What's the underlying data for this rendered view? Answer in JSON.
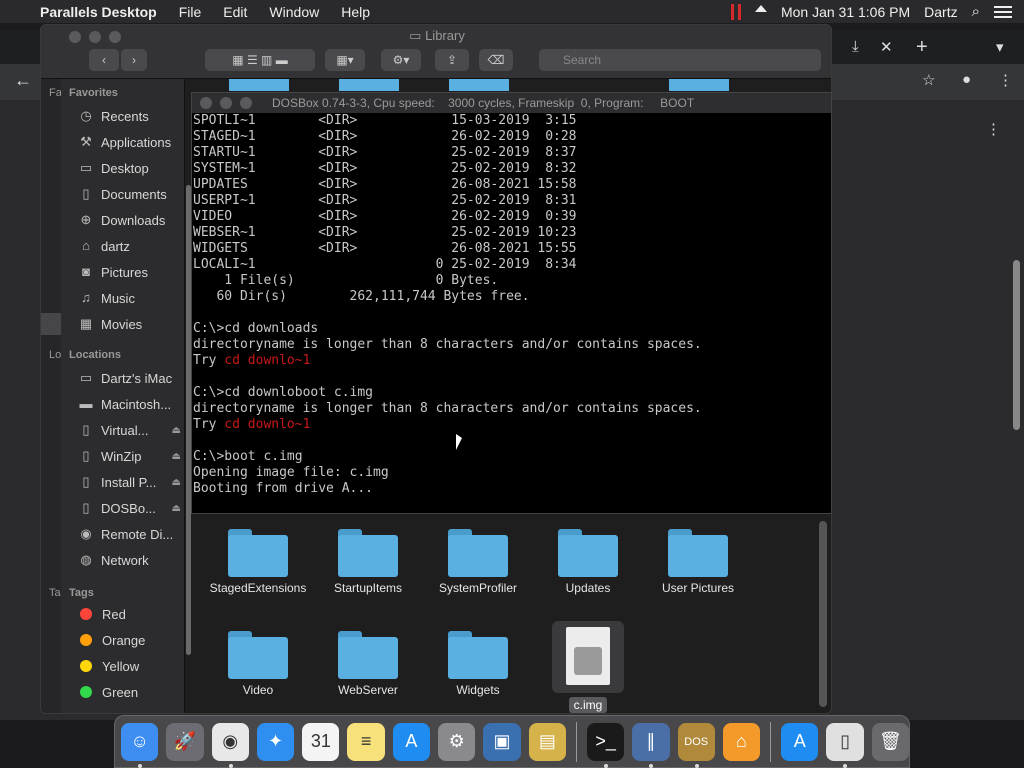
{
  "menubar": {
    "app": "Parallels Desktop",
    "items": [
      "File",
      "Edit",
      "Window",
      "Help"
    ],
    "datetime": "Mon Jan 31  1:06 PM",
    "user": "Dartz"
  },
  "finder": {
    "title": "Library",
    "search_placeholder": "Search",
    "favorites_header": "Favorites",
    "favorites": [
      {
        "label": "Recents",
        "icon": "clock-icon"
      },
      {
        "label": "Applications",
        "icon": "applications-icon"
      },
      {
        "label": "Desktop",
        "icon": "desktop-icon"
      },
      {
        "label": "Documents",
        "icon": "document-icon"
      },
      {
        "label": "Downloads",
        "icon": "download-icon"
      },
      {
        "label": "dartz",
        "icon": "home-icon"
      },
      {
        "label": "Pictures",
        "icon": "camera-icon"
      },
      {
        "label": "Music",
        "icon": "music-icon"
      },
      {
        "label": "Movies",
        "icon": "film-icon"
      }
    ],
    "locations_header": "Locations",
    "locations": [
      {
        "label": "Dartz's iMac",
        "icon": "computer-icon"
      },
      {
        "label": "Macintosh...",
        "icon": "disk-icon"
      },
      {
        "label": "Virtual...",
        "icon": "disk-icon"
      },
      {
        "label": "WinZip",
        "icon": "disk-icon"
      },
      {
        "label": "Install P...",
        "icon": "disk-icon"
      },
      {
        "label": "DOSBo...",
        "icon": "disk-icon"
      },
      {
        "label": "Remote Di...",
        "icon": "disc-icon"
      },
      {
        "label": "Network",
        "icon": "globe-icon"
      }
    ],
    "tags_header": "Tags",
    "tags": [
      {
        "label": "Red",
        "color": "#ff453a"
      },
      {
        "label": "Orange",
        "color": "#ff9f0a"
      },
      {
        "label": "Yellow",
        "color": "#ffd60a"
      },
      {
        "label": "Green",
        "color": "#32d74b"
      }
    ],
    "folders_row1": [
      "StagedExtensions",
      "StartupItems",
      "SystemProfiler",
      "Updates",
      "User Pictures"
    ],
    "folders_row2": [
      "Video",
      "WebServer",
      "Widgets"
    ],
    "selected_file": "c.img"
  },
  "dosbox": {
    "title": "DOSBox 0.74-3-3, Cpu speed:    3000 cycles, Frameskip  0, Program:     BOOT",
    "lines": [
      {
        "text": "SPOTLI~1        <DIR>            15-03-2019  3:15"
      },
      {
        "text": "STAGED~1        <DIR>            26-02-2019  0:28"
      },
      {
        "text": "STARTU~1        <DIR>            25-02-2019  8:37"
      },
      {
        "text": "SYSTEM~1        <DIR>            25-02-2019  8:32"
      },
      {
        "text": "UPDATES         <DIR>            26-08-2021 15:58"
      },
      {
        "text": "USERPI~1        <DIR>            25-02-2019  8:31"
      },
      {
        "text": "VIDEO           <DIR>            26-02-2019  0:39"
      },
      {
        "text": "WEBSER~1        <DIR>            25-02-2019 10:23"
      },
      {
        "text": "WIDGETS         <DIR>            26-08-2021 15:55"
      },
      {
        "text": "LOCALI~1                       0 25-02-2019  8:34"
      },
      {
        "text": "    1 File(s)                  0 Bytes."
      },
      {
        "text": "   60 Dir(s)        262,111,744 Bytes free."
      },
      {
        "text": ""
      },
      {
        "text": "C:\\>cd downloads"
      },
      {
        "text": "directoryname is longer than 8 characters and/or contains spaces."
      },
      {
        "text": "Try ",
        "red": "cd downlo~1"
      },
      {
        "text": ""
      },
      {
        "text": "C:\\>cd downloboot c.img"
      },
      {
        "text": "directoryname is longer than 8 characters and/or contains spaces."
      },
      {
        "text": "Try ",
        "red": "cd downlo~1"
      },
      {
        "text": ""
      },
      {
        "text": "C:\\>boot c.img"
      },
      {
        "text": "Opening image file: c.img"
      },
      {
        "text": "Booting from drive A..."
      },
      {
        "text": ""
      },
      {
        "text": "_"
      }
    ]
  },
  "dock": {
    "items": [
      {
        "name": "finder-icon",
        "glyph": "☺",
        "color": "#3d8ef0"
      },
      {
        "name": "launchpad-icon",
        "glyph": "🚀",
        "color": "#6c6c72"
      },
      {
        "name": "chrome-icon",
        "glyph": "◉",
        "color": "#e8e8e8"
      },
      {
        "name": "safari-icon",
        "glyph": "✦",
        "color": "#2f8ff0"
      },
      {
        "name": "calendar-icon",
        "glyph": "31",
        "color": "#f4f4f4"
      },
      {
        "name": "notes-icon",
        "glyph": "≡",
        "color": "#f6e17a"
      },
      {
        "name": "app-store-icon",
        "glyph": "A",
        "color": "#1e8cf0"
      },
      {
        "name": "system-preferences-icon",
        "glyph": "⚙",
        "color": "#8a8a8e"
      },
      {
        "name": "virtualbox-icon",
        "glyph": "▣",
        "color": "#3a6fb0"
      },
      {
        "name": "archive-utility-icon",
        "glyph": "▤",
        "color": "#d6b24a"
      },
      {
        "name": "terminal-icon",
        "glyph": ">_",
        "color": "#1a1a1a"
      },
      {
        "name": "parallels-icon",
        "glyph": "∥",
        "color": "#4a6ea8"
      },
      {
        "name": "dosbox-icon",
        "glyph": "DOS",
        "color": "#b08a3a"
      },
      {
        "name": "home-app-icon",
        "glyph": "⌂",
        "color": "#f39a2a"
      },
      {
        "name": "downloads-stack-icon",
        "glyph": "A",
        "color": "#1e8cf0"
      },
      {
        "name": "image-file-icon",
        "glyph": "▯",
        "color": "#e0e0e0"
      },
      {
        "name": "trash-icon",
        "glyph": "🗑",
        "color": "#6a6a6e"
      }
    ]
  }
}
